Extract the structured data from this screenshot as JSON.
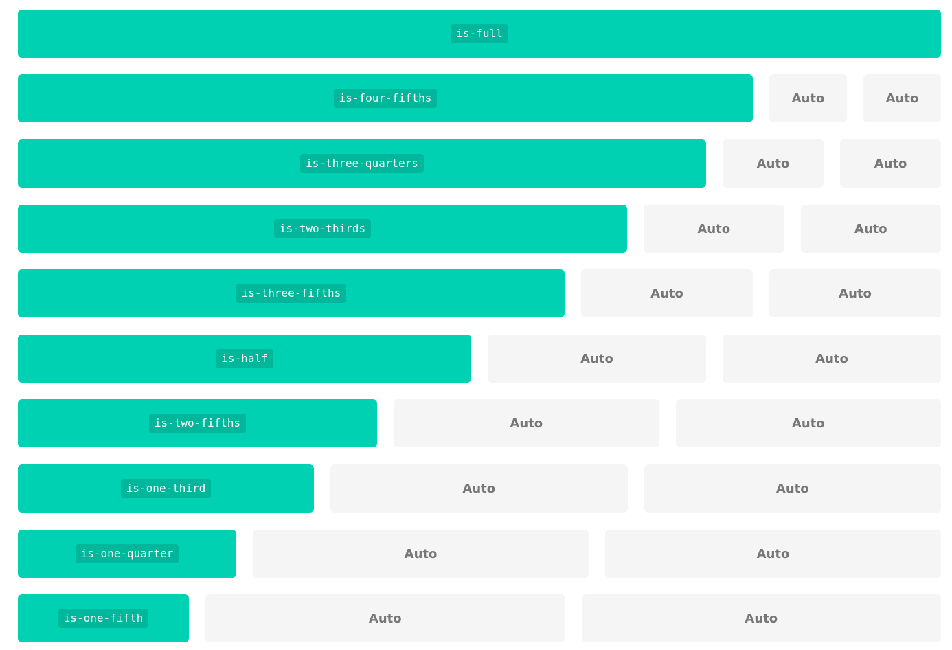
{
  "auto_label": "Auto",
  "colors": {
    "primary": "#00d1b2",
    "auto_background": "#f5f5f5",
    "auto_text": "#777777"
  },
  "rows": [
    {
      "class_name": "is-full"
    },
    {
      "class_name": "is-four-fifths",
      "auto": [
        "Auto",
        "Auto"
      ]
    },
    {
      "class_name": "is-three-quarters",
      "auto": [
        "Auto",
        "Auto"
      ]
    },
    {
      "class_name": "is-two-thirds",
      "auto": [
        "Auto",
        "Auto"
      ]
    },
    {
      "class_name": "is-three-fifths",
      "auto": [
        "Auto",
        "Auto"
      ]
    },
    {
      "class_name": "is-half",
      "auto": [
        "Auto",
        "Auto"
      ]
    },
    {
      "class_name": "is-two-fifths",
      "auto": [
        "Auto",
        "Auto"
      ]
    },
    {
      "class_name": "is-one-third",
      "auto": [
        "Auto",
        "Auto"
      ]
    },
    {
      "class_name": "is-one-quarter",
      "auto": [
        "Auto",
        "Auto"
      ]
    },
    {
      "class_name": "is-one-fifth",
      "auto": [
        "Auto",
        "Auto"
      ]
    }
  ]
}
